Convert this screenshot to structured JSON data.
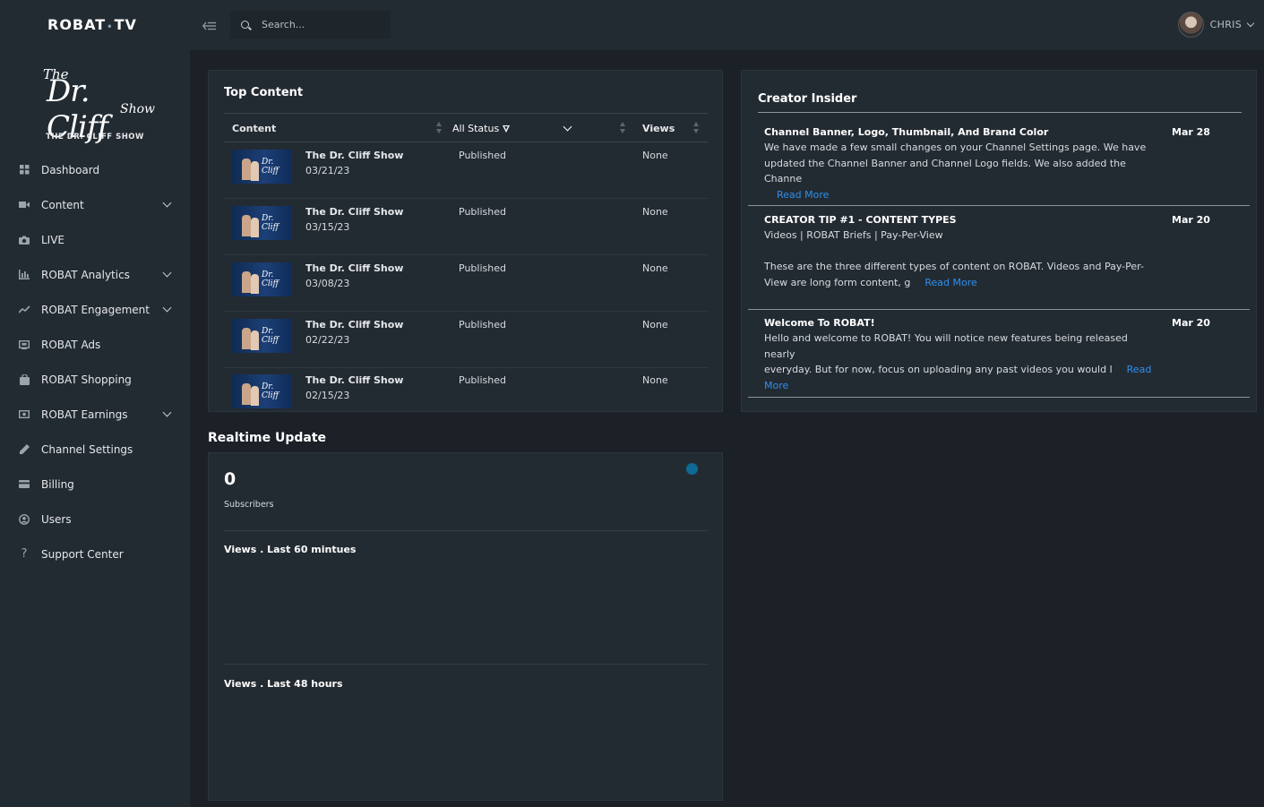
{
  "brand": {
    "logo_left": "ROBAT",
    "logo_dot": "•",
    "logo_right": "TV"
  },
  "show": {
    "logo_the": "The",
    "logo_name": "Dr. Cliff",
    "logo_show": "Show",
    "title": "THE DR. CLIFF SHOW"
  },
  "sidebar": {
    "items": [
      {
        "label": "Dashboard",
        "icon": "dashboard-icon",
        "has_submenu": false
      },
      {
        "label": "Content",
        "icon": "video-camera-icon",
        "has_submenu": true
      },
      {
        "label": "LIVE",
        "icon": "camera-icon",
        "has_submenu": false
      },
      {
        "label": "ROBAT Analytics",
        "icon": "bar-chart-icon",
        "has_submenu": true
      },
      {
        "label": "ROBAT Engagement",
        "icon": "trend-line-icon",
        "has_submenu": true
      },
      {
        "label": "ROBAT Ads",
        "icon": "ad-screen-icon",
        "has_submenu": false
      },
      {
        "label": "ROBAT Shopping",
        "icon": "shopping-bag-icon",
        "has_submenu": false
      },
      {
        "label": "ROBAT Earnings",
        "icon": "money-icon",
        "has_submenu": true
      },
      {
        "label": "Channel Settings",
        "icon": "pencil-icon",
        "has_submenu": false
      },
      {
        "label": "Billing",
        "icon": "credit-card-icon",
        "has_submenu": false
      },
      {
        "label": "Users",
        "icon": "users-icon",
        "has_submenu": false
      },
      {
        "label": "Support Center",
        "icon": "question-icon",
        "has_submenu": false
      }
    ]
  },
  "topbar": {
    "search_placeholder": "Search...",
    "user_name": "CHRIS"
  },
  "top_content": {
    "title": "Top Content",
    "columns": {
      "content": "Content",
      "status": "All Status",
      "views": "Views"
    },
    "rows": [
      {
        "title": "The Dr. Cliff Show",
        "date": "03/21/23",
        "status": "Published",
        "views": "None"
      },
      {
        "title": "The Dr. Cliff Show",
        "date": "03/15/23",
        "status": "Published",
        "views": "None"
      },
      {
        "title": "The Dr. Cliff Show",
        "date": "03/08/23",
        "status": "Published",
        "views": "None"
      },
      {
        "title": "The Dr. Cliff Show",
        "date": "02/22/23",
        "status": "Published",
        "views": "None"
      },
      {
        "title": "The Dr. Cliff Show",
        "date": "02/15/23",
        "status": "Published",
        "views": "None"
      }
    ],
    "thumb_text": "Dr. Cliff"
  },
  "insider": {
    "title": "Creator Insider",
    "posts": [
      {
        "title": "Channel Banner, Logo, Thumbnail, And Brand Color",
        "date": "Mar 28",
        "line1": "We have made a few small changes on your Channel Settings page. We have",
        "line2": "updated the Channel Banner and Channel Logo fields. We also added the Channe",
        "link": "Read More"
      },
      {
        "title": "CREATOR TIP #1 - CONTENT TYPES",
        "date": "Mar 20",
        "subtitle": "Videos | ROBAT Briefs | Pay-Per-View",
        "line1": "These are the three different types of content on ROBAT. Videos and Pay-Per-",
        "line2": "View are long form content, g",
        "link": "Read More"
      },
      {
        "title": "Welcome To ROBAT!",
        "date": "Mar 20",
        "line1": "Hello and welcome to ROBAT! You will notice new features being released nearly",
        "line2": "everyday. But for now, focus on uploading any past videos you would l",
        "link_a": "Read",
        "link_b": "More"
      }
    ]
  },
  "realtime": {
    "title": "Realtime Update",
    "subscribers_count": "0",
    "subscribers_label": "Subscribers",
    "views_60": "Views . Last 60 mintues",
    "views_48": "Views . Last 48 hours"
  },
  "colors": {
    "background": "#1b2127",
    "panel": "#232b32",
    "link": "#2f8fef",
    "dot": "#0e6a94"
  }
}
